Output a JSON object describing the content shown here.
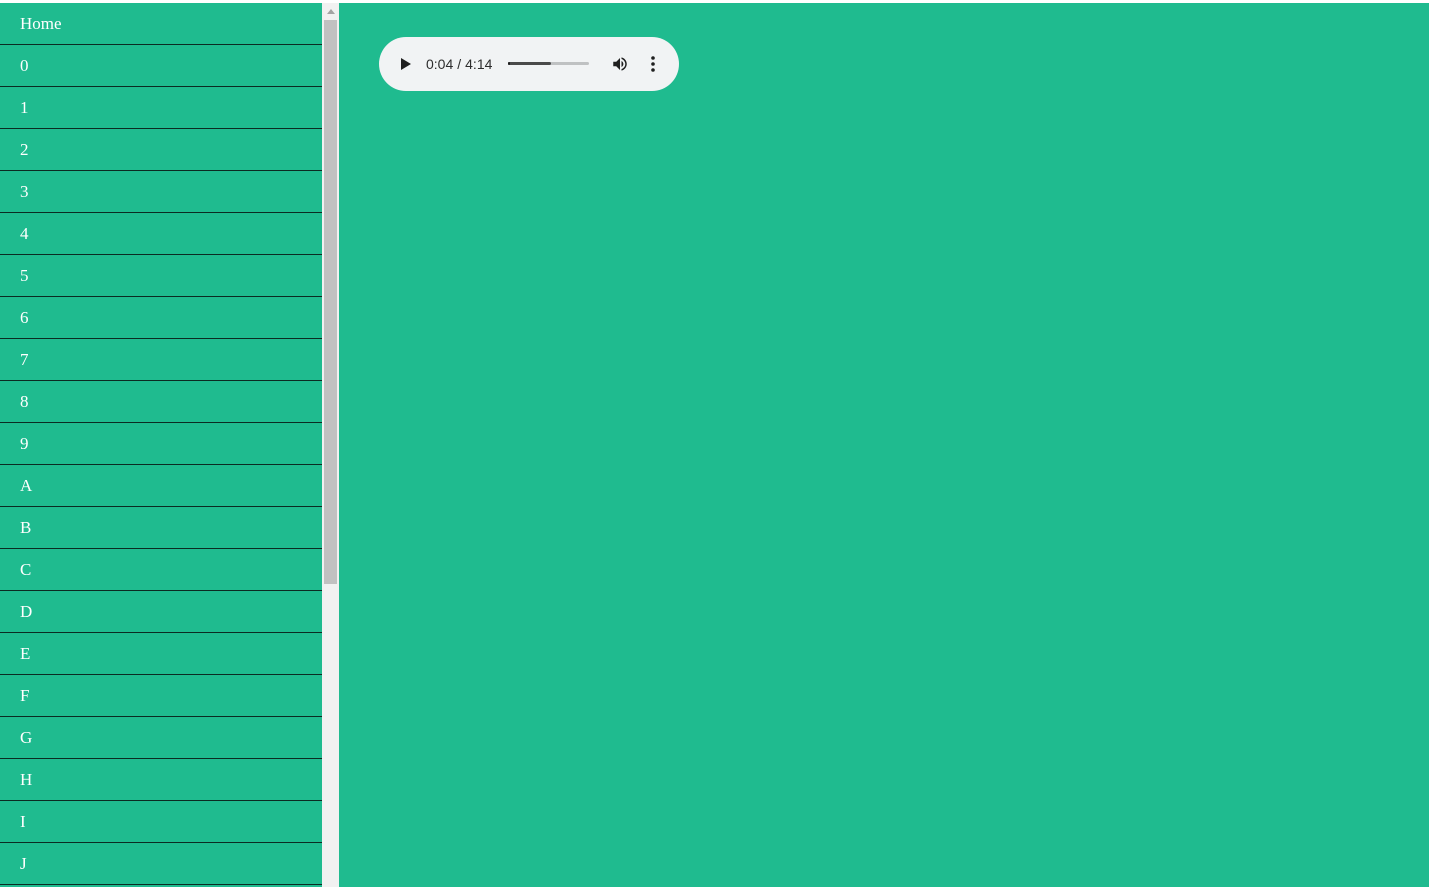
{
  "theme": {
    "accent": "#1fbb8f",
    "divider": "#0b2b22",
    "text": "#ffffff",
    "player_bg": "#f1f3f4"
  },
  "sidebar": {
    "items": [
      {
        "label": "Home"
      },
      {
        "label": "0"
      },
      {
        "label": "1"
      },
      {
        "label": "2"
      },
      {
        "label": "3"
      },
      {
        "label": "4"
      },
      {
        "label": "5"
      },
      {
        "label": "6"
      },
      {
        "label": "7"
      },
      {
        "label": "8"
      },
      {
        "label": "9"
      },
      {
        "label": "A"
      },
      {
        "label": "B"
      },
      {
        "label": "C"
      },
      {
        "label": "D"
      },
      {
        "label": "E"
      },
      {
        "label": "F"
      },
      {
        "label": "G"
      },
      {
        "label": "H"
      },
      {
        "label": "I"
      },
      {
        "label": "J"
      }
    ]
  },
  "audio": {
    "current_time": "0:04",
    "separator": "/",
    "duration": "4:14",
    "played_fraction": 0.02,
    "buffered_fraction": 0.53,
    "icons": {
      "play": "play-icon",
      "volume": "volume-icon",
      "more": "more-vert-icon"
    }
  }
}
